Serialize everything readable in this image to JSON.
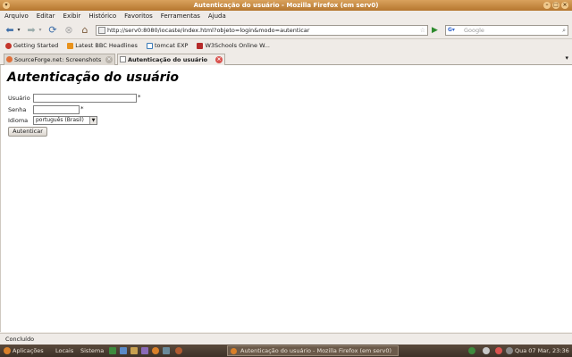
{
  "window": {
    "title": "Autenticação do usuário - Mozilla Firefox (em serv0)"
  },
  "menu": [
    "Arquivo",
    "Editar",
    "Exibir",
    "Histórico",
    "Favoritos",
    "Ferramentas",
    "Ajuda"
  ],
  "nav": {
    "back_icon": "back-arrow",
    "forward_icon": "forward-arrow",
    "reload_icon": "reload",
    "stop_icon": "stop",
    "home_icon": "home",
    "url": "http://serv0:8080/iocaste/index.html?objeto=login&modo=autenticar",
    "search_placeholder": "Google"
  },
  "bookmarks": [
    {
      "label": "Getting Started",
      "icon": "firefox-icon",
      "color": "#c4362c"
    },
    {
      "label": "Latest BBC Headlines",
      "icon": "rss-icon",
      "color": "#e8921c"
    },
    {
      "label": "tomcat EXP",
      "icon": "page-icon",
      "color": "#3a7ab8"
    },
    {
      "label": "W3Schools Online W...",
      "icon": "w3schools-icon",
      "color": "#b52a2a"
    }
  ],
  "tabs": [
    {
      "label": "SourceForge.net: Screenshots",
      "active": false
    },
    {
      "label": "Autenticação do usuário",
      "active": true
    }
  ],
  "page": {
    "heading": "Autenticação do usuário",
    "fields": {
      "usuario_label": "Usuário",
      "usuario_value": "",
      "senha_label": "Senha",
      "senha_value": "",
      "idioma_label": "Idioma",
      "idioma_value": "português (Brasil)",
      "required_marker": "*"
    },
    "submit_label": "Autenticar"
  },
  "status": {
    "text": "Concluído"
  },
  "taskbar": {
    "menus": [
      "Aplicações",
      "Locais",
      "Sistema"
    ],
    "window_label": "Autenticação do usuário - Mozilla Firefox (em serv0)",
    "clock": "Qua 07 Mar, 23:36"
  }
}
